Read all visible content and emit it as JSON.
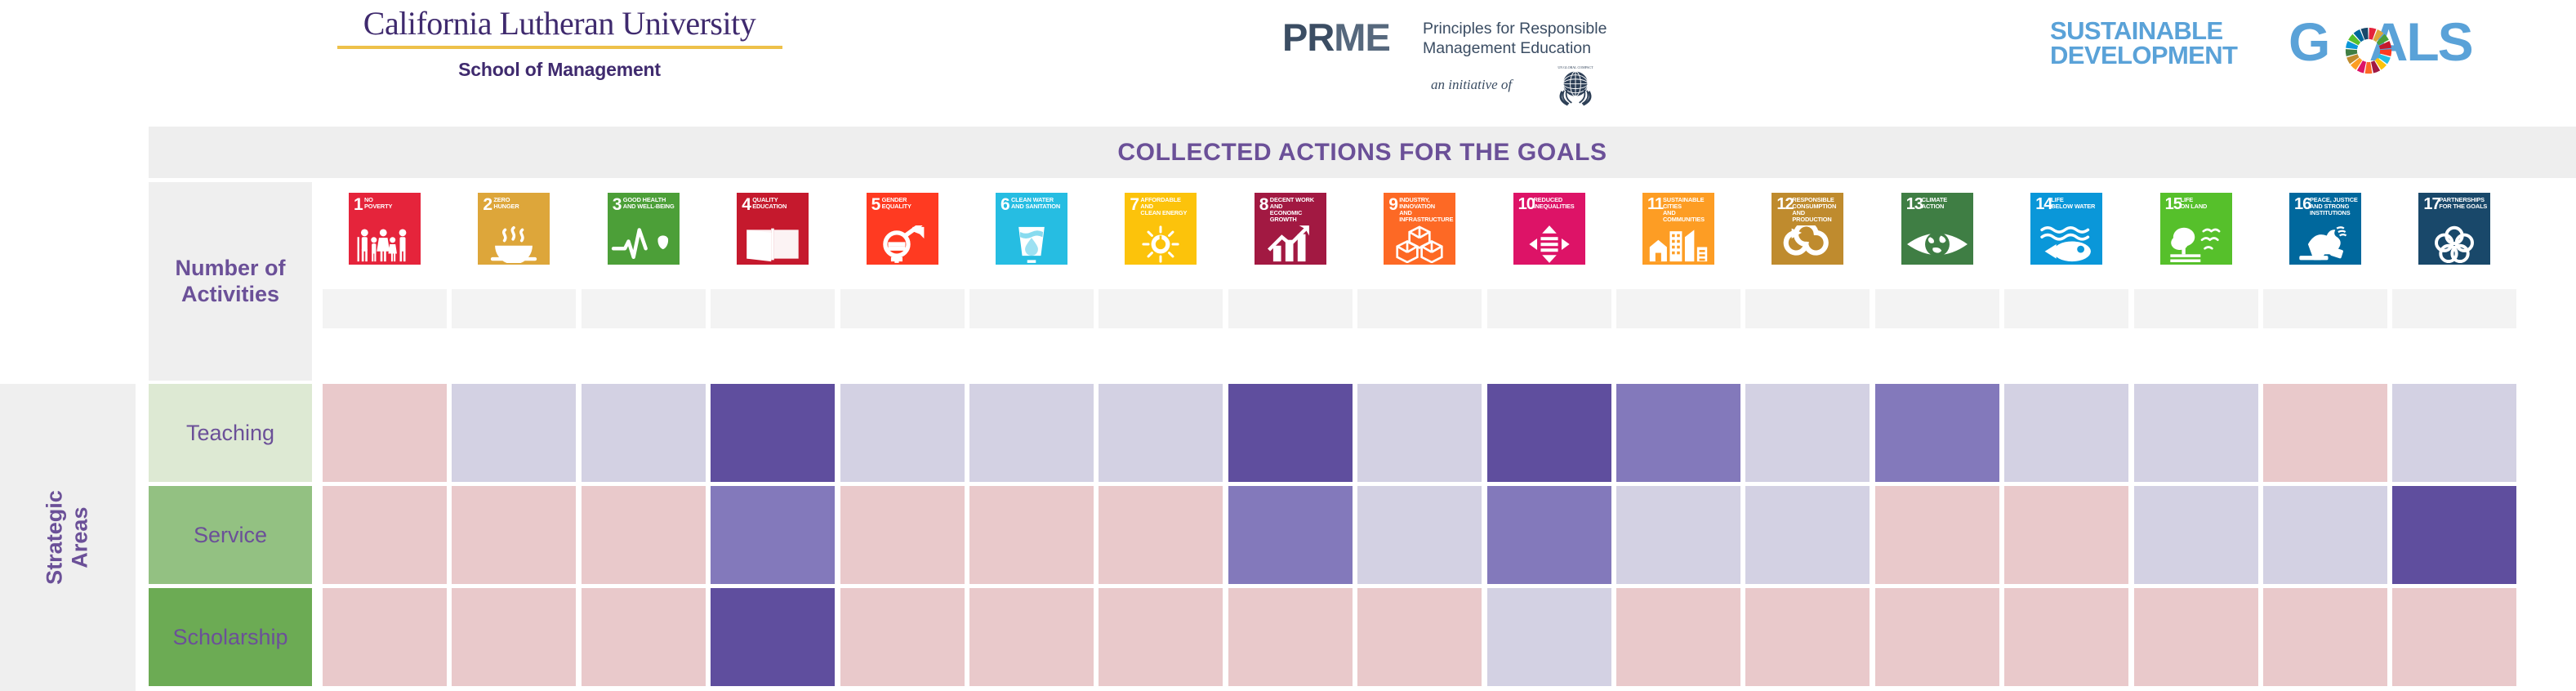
{
  "header": {
    "university": {
      "name": "California Lutheran University",
      "division": "School of Management",
      "rule_color": "#eec14a",
      "brand_color": "#3f2a6e"
    },
    "prme": {
      "acronym_1": "PR",
      "acronym_2": "ME",
      "tagline": "Principles for Responsible\nManagement Education",
      "initiative": "an initiative of",
      "emblem_label": "UN GLOBAL COMPACT",
      "brand_color": "#3b4d63"
    },
    "sdg_logo": {
      "words": "SUSTAINABLE\nDEVELOPMENT",
      "goals": "G ALS",
      "goals_before": "G",
      "goals_after": "ALS",
      "brand_color": "#5aa2d8"
    }
  },
  "title_bar": {
    "title": "COLLECTED ACTIONS FOR THE GOALS",
    "title_color": "#6b5098",
    "background": "#eeeeee"
  },
  "row_header": {
    "number_of_activities": "Number of\nActivities",
    "strategic_areas": "Strategic\nAreas"
  },
  "strategic_areas": [
    {
      "label": "Teaching",
      "swatch": "#dde9d3"
    },
    {
      "label": "Service",
      "swatch": "#93c182"
    },
    {
      "label": "Scholarship",
      "swatch": "#6cab54"
    }
  ],
  "legend_colors": {
    "pink": "#e9c9cb",
    "lavender": "#d3d1e3",
    "medium_purple": "#8379bb",
    "deep_purple": "#5f4e9e"
  },
  "goals": [
    {
      "num": "1",
      "label": "NO\nPOVERTY",
      "color": "#e5243b",
      "icon": "family-group-icon"
    },
    {
      "num": "2",
      "label": "ZERO\nHUNGER",
      "color": "#dda63a",
      "icon": "steaming-bowl-icon"
    },
    {
      "num": "3",
      "label": "GOOD HEALTH\nAND WELL-BEING",
      "color": "#4c9f38",
      "icon": "heartbeat-line-icon"
    },
    {
      "num": "4",
      "label": "QUALITY\nEDUCATION",
      "color": "#c5192d",
      "icon": "open-book-icon"
    },
    {
      "num": "5",
      "label": "GENDER\nEQUALITY",
      "color": "#ff3a21",
      "icon": "gender-equality-icon"
    },
    {
      "num": "6",
      "label": "CLEAN WATER\nAND SANITATION",
      "color": "#26bde2",
      "icon": "water-glass-droplet-icon"
    },
    {
      "num": "7",
      "label": "AFFORDABLE AND\nCLEAN ENERGY",
      "color": "#fcc30b",
      "icon": "sun-power-icon"
    },
    {
      "num": "8",
      "label": "DECENT WORK AND\nECONOMIC GROWTH",
      "color": "#a21942",
      "icon": "growth-bar-chart-icon"
    },
    {
      "num": "9",
      "label": "INDUSTRY, INNOVATION\nAND INFRASTRUCTURE",
      "color": "#fd6925",
      "icon": "stacked-cubes-icon"
    },
    {
      "num": "10",
      "label": "REDUCED\nINEQUALITIES",
      "color": "#dd1367",
      "icon": "four-arrows-equals-icon"
    },
    {
      "num": "11",
      "label": "SUSTAINABLE CITIES\nAND COMMUNITIES",
      "color": "#fd9d24",
      "icon": "city-buildings-icon"
    },
    {
      "num": "12",
      "label": "RESPONSIBLE\nCONSUMPTION\nAND PRODUCTION",
      "color": "#bf8b2e",
      "icon": "infinity-loop-icon"
    },
    {
      "num": "13",
      "label": "CLIMATE\nACTION",
      "color": "#3f7e44",
      "icon": "eye-earth-icon"
    },
    {
      "num": "14",
      "label": "LIFE\nBELOW WATER",
      "color": "#0a97d9",
      "icon": "fish-waves-icon"
    },
    {
      "num": "15",
      "label": "LIFE\nON LAND",
      "color": "#56c02b",
      "icon": "tree-birds-icon"
    },
    {
      "num": "16",
      "label": "PEACE, JUSTICE\nAND STRONG\nINSTITUTIONS",
      "color": "#00689d",
      "icon": "dove-gavel-icon"
    },
    {
      "num": "17",
      "label": "PARTNERSHIPS\nFOR THE GOALS",
      "color": "#19486a",
      "icon": "interlocking-circles-icon"
    }
  ],
  "chart_data": {
    "type": "heatmap",
    "title": "COLLECTED ACTIONS FOR THE GOALS",
    "xlabel": "Number of Activities",
    "ylabel": "Strategic Areas",
    "grid": true,
    "legend_position": "none",
    "categories": [
      "1",
      "2",
      "3",
      "4",
      "5",
      "6",
      "7",
      "8",
      "9",
      "10",
      "11",
      "12",
      "13",
      "14",
      "15",
      "16",
      "17"
    ],
    "category_labels": [
      "No Poverty",
      "Zero Hunger",
      "Good Health and Well-Being",
      "Quality Education",
      "Gender Equality",
      "Clean Water and Sanitation",
      "Affordable and Clean Energy",
      "Decent Work and Economic Growth",
      "Industry, Innovation and Infrastructure",
      "Reduced Inequalities",
      "Sustainable Cities and Communities",
      "Responsible Consumption and Production",
      "Climate Action",
      "Life Below Water",
      "Life on Land",
      "Peace, Justice and Strong Institutions",
      "Partnerships for the Goals"
    ],
    "rows": [
      "Teaching",
      "Service",
      "Scholarship"
    ],
    "scale": {
      "pink": "#e9c9cb",
      "lavender": "#d3d1e3",
      "medium_purple": "#8379bb",
      "deep_purple": "#5f4e9e"
    },
    "series": [
      {
        "name": "Teaching",
        "values": [
          "pink",
          "lavender",
          "lavender",
          "deep_purple",
          "lavender",
          "lavender",
          "lavender",
          "deep_purple",
          "lavender",
          "deep_purple",
          "medium_purple",
          "lavender",
          "medium_purple",
          "lavender",
          "lavender",
          "pink",
          "lavender"
        ]
      },
      {
        "name": "Service",
        "values": [
          "pink",
          "pink",
          "pink",
          "medium_purple",
          "pink",
          "pink",
          "pink",
          "medium_purple",
          "lavender",
          "medium_purple",
          "lavender",
          "lavender",
          "pink",
          "pink",
          "lavender",
          "lavender",
          "deep_purple"
        ]
      },
      {
        "name": "Scholarship",
        "values": [
          "pink",
          "pink",
          "pink",
          "deep_purple",
          "pink",
          "pink",
          "pink",
          "pink",
          "pink",
          "lavender",
          "pink",
          "pink",
          "pink",
          "pink",
          "pink",
          "pink",
          "pink"
        ]
      }
    ]
  }
}
